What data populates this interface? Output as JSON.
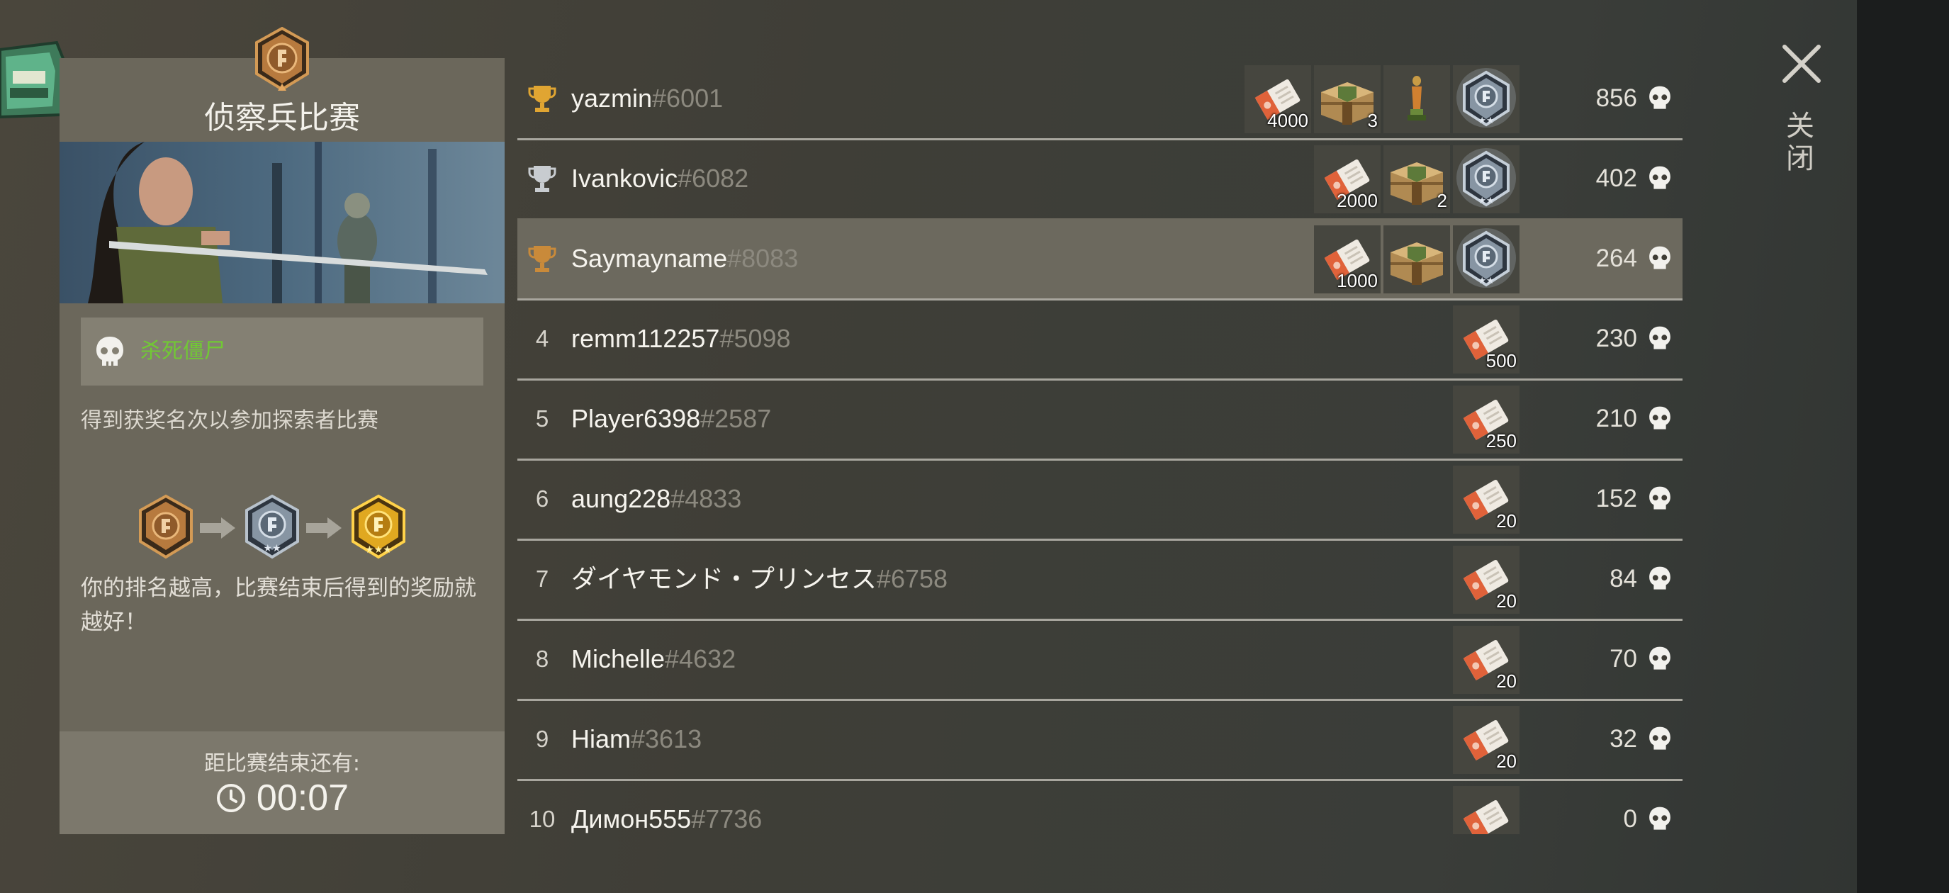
{
  "event": {
    "title": "侦察兵比赛",
    "objective": "杀死僵尸",
    "description": "得到获奖名次以参加探索者比赛",
    "reward_note": "你的排名越高，比赛结束后得到的奖励就越好！",
    "timer_label": "距比赛结束还有:",
    "timer_value": "00:07"
  },
  "close": {
    "label": "关闭"
  },
  "leaderboard": [
    {
      "rank": "1",
      "medal": "gold",
      "name": "yazmin",
      "tag": "#6001",
      "score": "856",
      "rewards": [
        {
          "icon": "ticket-icon",
          "count": "4000"
        },
        {
          "icon": "crate-icon",
          "count": "3"
        },
        {
          "icon": "trophy-statue-icon",
          "count": ""
        },
        {
          "icon": "silver-badge-icon",
          "count": ""
        }
      ]
    },
    {
      "rank": "2",
      "medal": "silver",
      "name": "Ivankovic",
      "tag": "#6082",
      "score": "402",
      "rewards": [
        {
          "icon": "ticket-icon",
          "count": "2000"
        },
        {
          "icon": "crate-icon",
          "count": "2"
        },
        {
          "icon": "silver-badge-icon",
          "count": ""
        }
      ]
    },
    {
      "rank": "3",
      "medal": "bronze",
      "name": "Saymayname",
      "tag": "#8083",
      "score": "264",
      "highlight": true,
      "rewards": [
        {
          "icon": "ticket-icon",
          "count": "1000"
        },
        {
          "icon": "crate-icon",
          "count": ""
        },
        {
          "icon": "silver-badge-icon",
          "count": ""
        }
      ]
    },
    {
      "rank": "4",
      "name": "remm112257",
      "tag": "#5098",
      "score": "230",
      "rewards": [
        {
          "icon": "ticket-icon",
          "count": "500"
        }
      ]
    },
    {
      "rank": "5",
      "name": "Player6398",
      "tag": "#2587",
      "score": "210",
      "rewards": [
        {
          "icon": "ticket-icon",
          "count": "250"
        }
      ]
    },
    {
      "rank": "6",
      "name": "aung228",
      "tag": "#4833",
      "score": "152",
      "rewards": [
        {
          "icon": "ticket-icon",
          "count": "20"
        }
      ]
    },
    {
      "rank": "7",
      "name": "ダイヤモンド・プリンセス",
      "tag": "#6758",
      "score": "84",
      "rewards": [
        {
          "icon": "ticket-icon",
          "count": "20"
        }
      ]
    },
    {
      "rank": "8",
      "name": "Michelle",
      "tag": "#4632",
      "score": "70",
      "rewards": [
        {
          "icon": "ticket-icon",
          "count": "20"
        }
      ]
    },
    {
      "rank": "9",
      "name": "Hiam",
      "tag": "#3613",
      "score": "32",
      "rewards": [
        {
          "icon": "ticket-icon",
          "count": "20"
        }
      ]
    },
    {
      "rank": "10",
      "name": "Димон555",
      "tag": "#7736",
      "score": "0",
      "rewards": [
        {
          "icon": "ticket-icon",
          "count": ""
        }
      ]
    }
  ],
  "colors": {
    "objective_text": "#71c934",
    "gold": "#e0a532",
    "silver": "#c8ccd0",
    "bronze": "#c98a3a",
    "tag": "#8c897f"
  }
}
